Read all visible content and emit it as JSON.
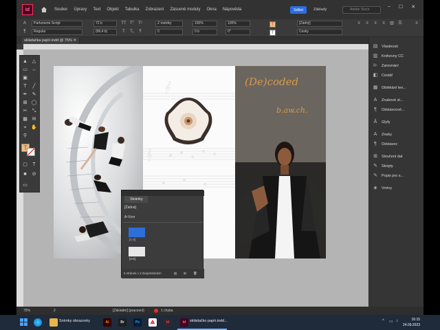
{
  "app": {
    "logo": "Id",
    "menus": [
      "Soubor",
      "Úpravy",
      "Text",
      "Objekt",
      "Tabulka",
      "Zobrazení",
      "Zásuvné moduly",
      "Okna",
      "Nápověda"
    ],
    "share": "Sdílet",
    "workspace": "Základy",
    "stock_search_placeholder": "Adobe Stock"
  },
  "control_panel": {
    "font": "Parfumerie Script",
    "style": "Regular",
    "size": "72 b",
    "leading": "(86,4 b)",
    "kerning": "Z metriky",
    "tracking": "0",
    "scale_v": "100%",
    "scale_h": "100%",
    "baseline": "0 b",
    "skew": "0°",
    "char_style": "[Žádný]",
    "lang": "Česky"
  },
  "document": {
    "tab_label": "skládačka papír.indd @ 75%",
    "title_text": "(De)coded",
    "subtitle_text": "b.aw.ch."
  },
  "pages_panel": {
    "title": "Stránky",
    "none_master": "[Žádná]",
    "a_master": "A-Vzor",
    "spread1_label": "[1-3]",
    "spread2_label": "[4-6]",
    "footer": "6 stránek v 2 dvojstránkách"
  },
  "dock": {
    "items": [
      "Vlastnosti",
      "Knihovny CC",
      "Zarovnání",
      "Cestář",
      "Obtékání tex...",
      "Znakové st...",
      "Odstavcové...",
      "Glyfy",
      "Znaky",
      "Odstavec",
      "Sloučení dat",
      "Skripty",
      "Popis pro s...",
      "Vrstvy"
    ]
  },
  "status": {
    "zoom": "75%",
    "page": "2",
    "master": "[Základní] (pracovní)",
    "errors": "1 chyba"
  },
  "taskbar": {
    "explorer_label": "Snímky obrazovky",
    "indesign_label": "skládačko papír.indd...",
    "ai": "Ai",
    "br": "Br",
    "ps": "Ps",
    "id": "Id",
    "time": "16:15",
    "date": "24.09.2023"
  },
  "colors": {
    "accent": "#2b6ee3",
    "id_brand": "#ff3366",
    "title_gold": "#d89a45"
  }
}
